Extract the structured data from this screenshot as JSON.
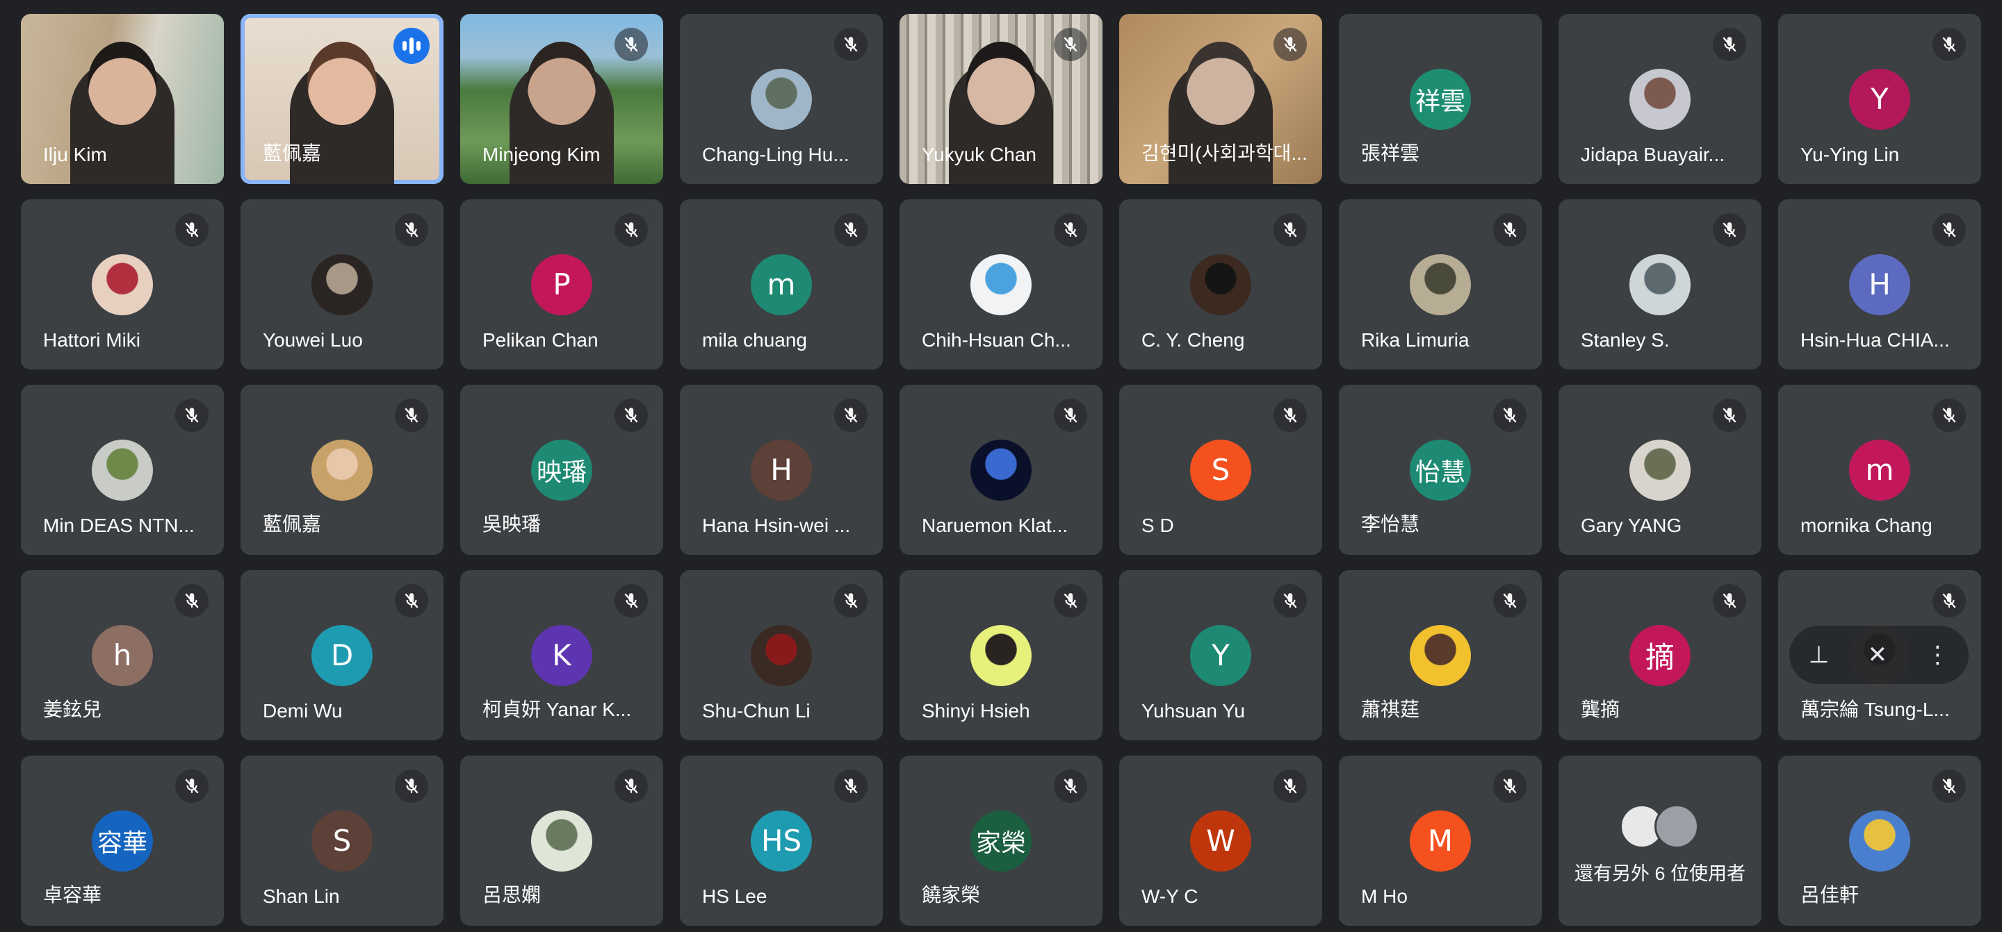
{
  "participants": [
    {
      "name": "Ilju Kim",
      "type": "video",
      "bg": "v1",
      "skin": "#d9b39a",
      "hair": "#1e1a18"
    },
    {
      "name": "藍佩嘉",
      "type": "video",
      "bg": "v2",
      "skin": "#e3b9a0",
      "hair": "#5a3a2a",
      "speaking": true
    },
    {
      "name": "Minjeong Kim",
      "type": "video",
      "bg": "v3",
      "skin": "#c9a48c",
      "hair": "#2b2420",
      "muted": true
    },
    {
      "name": "Chang-Ling Hu...",
      "type": "photo",
      "photo_colors": [
        "#9fb6c9",
        "#5f7060"
      ],
      "muted": true
    },
    {
      "name": "Yukyuk Chan",
      "type": "video",
      "bg": "v5",
      "skin": "#d6b8a4",
      "hair": "#1d1a19",
      "muted": true
    },
    {
      "name": "김현미(사회과학대...",
      "type": "video",
      "bg": "v6",
      "skin": "#cdb3a0",
      "hair": "#3a3330",
      "muted": true
    },
    {
      "name": "張祥雲",
      "type": "initial",
      "initial": "祥雲",
      "color": "#1e8e73"
    },
    {
      "name": "Jidapa Buayair...",
      "type": "photo",
      "photo_colors": [
        "#c7c7cf",
        "#7d5a50"
      ],
      "muted": true
    },
    {
      "name": "Yu-Ying Lin",
      "type": "initial",
      "initial": "Y",
      "color": "#b3185a",
      "muted": true
    },
    {
      "name": "Hattori Miki",
      "type": "photo",
      "photo_colors": [
        "#e8d0c0",
        "#b03040"
      ],
      "muted": true
    },
    {
      "name": "Youwei Luo",
      "type": "photo",
      "photo_colors": [
        "#2a2522",
        "#a89888"
      ],
      "muted": true
    },
    {
      "name": "Pelikan Chan",
      "type": "initial",
      "initial": "P",
      "color": "#c2185b",
      "muted": true
    },
    {
      "name": "mila chuang",
      "type": "initial",
      "initial": "m",
      "color": "#1e8a73",
      "muted": true
    },
    {
      "name": "Chih-Hsuan Ch...",
      "type": "photo",
      "photo_colors": [
        "#f1f3f4",
        "#4aa3df"
      ],
      "muted": true
    },
    {
      "name": "C. Y. Cheng",
      "type": "photo",
      "photo_colors": [
        "#3c2a20",
        "#151515"
      ],
      "muted": true
    },
    {
      "name": "Rika Limuria",
      "type": "photo",
      "photo_colors": [
        "#b7ad95",
        "#4a4a3a"
      ],
      "muted": true
    },
    {
      "name": "Stanley S.",
      "type": "photo",
      "photo_colors": [
        "#cfd6d8",
        "#5d6a70"
      ],
      "muted": true
    },
    {
      "name": "Hsin-Hua CHIA...",
      "type": "initial",
      "initial": "H",
      "color": "#5c6bc0",
      "muted": true
    },
    {
      "name": "Min DEAS NTN...",
      "type": "photo",
      "photo_colors": [
        "#c9cbc7",
        "#6d8a4a"
      ],
      "muted": true
    },
    {
      "name": "藍佩嘉",
      "type": "photo",
      "photo_colors": [
        "#c9a26a",
        "#e8c7a8"
      ],
      "muted": true
    },
    {
      "name": "吳映璠",
      "type": "initial",
      "initial": "映璠",
      "color": "#1e8a73",
      "muted": true
    },
    {
      "name": "Hana Hsin-wei ...",
      "type": "initial",
      "initial": "H",
      "color": "#5d4037",
      "muted": true
    },
    {
      "name": "Naruemon Klat...",
      "type": "photo",
      "photo_colors": [
        "#0a0f2a",
        "#3a6ad0"
      ],
      "muted": true
    },
    {
      "name": "S D",
      "type": "initial",
      "initial": "S",
      "color": "#f4511e",
      "muted": true
    },
    {
      "name": "李怡慧",
      "type": "initial",
      "initial": "怡慧",
      "color": "#1e8a73",
      "muted": true
    },
    {
      "name": "Gary YANG",
      "type": "photo",
      "photo_colors": [
        "#d8d4cc",
        "#6a6f55"
      ],
      "muted": true
    },
    {
      "name": "mornika Chang",
      "type": "initial",
      "initial": "m",
      "color": "#c2185b",
      "muted": true
    },
    {
      "name": "姜鉉兒",
      "type": "initial",
      "initial": "h",
      "color": "#8d6e63",
      "muted": true
    },
    {
      "name": "Demi Wu",
      "type": "initial",
      "initial": "D",
      "color": "#1e9bb0",
      "muted": true
    },
    {
      "name": "柯貞妍 Yanar K...",
      "type": "initial",
      "initial": "K",
      "color": "#5e35b1",
      "muted": true
    },
    {
      "name": "Shu-Chun Li",
      "type": "photo",
      "photo_colors": [
        "#3a2a24",
        "#8a1a1a"
      ],
      "muted": true
    },
    {
      "name": "Shinyi Hsieh",
      "type": "photo",
      "photo_colors": [
        "#e6f07a",
        "#2a2420"
      ],
      "muted": true
    },
    {
      "name": "Yuhsuan Yu",
      "type": "initial",
      "initial": "Y",
      "color": "#1e8a73",
      "muted": true
    },
    {
      "name": "蕭祺莛",
      "type": "photo",
      "photo_colors": [
        "#f2c12e",
        "#5a3a2a"
      ],
      "muted": true
    },
    {
      "name": "龔摘",
      "type": "initial",
      "initial": "摘",
      "color": "#c2185b",
      "muted": true
    },
    {
      "name": "萬宗綸 Tsung-L...",
      "type": "photo",
      "photo_colors": [
        "#4a4040",
        "#2a2626"
      ],
      "muted": true,
      "hovered": true
    },
    {
      "name": "卓容華",
      "type": "initial",
      "initial": "容華",
      "color": "#1565c0",
      "muted": true
    },
    {
      "name": "Shan Lin",
      "type": "initial",
      "initial": "S",
      "color": "#5d4037",
      "muted": true
    },
    {
      "name": "呂思嫻",
      "type": "photo",
      "photo_colors": [
        "#dfe6d8",
        "#6a7a60"
      ],
      "muted": true
    },
    {
      "name": "HS Lee",
      "type": "initial",
      "initial": "HS",
      "color": "#1e9bb0",
      "muted": true
    },
    {
      "name": "饒家榮",
      "type": "initial",
      "initial": "家榮",
      "color": "#1b5e40",
      "muted": true
    },
    {
      "name": "W-Y C",
      "type": "initial",
      "initial": "W",
      "color": "#bf360c",
      "muted": true
    },
    {
      "name": "M Ho",
      "type": "initial",
      "initial": "M",
      "color": "#f4511e",
      "muted": true
    },
    {
      "name": "",
      "type": "others",
      "others_label": "還有另外 6 位使用者"
    },
    {
      "name": "呂佳軒",
      "type": "photo",
      "photo_colors": [
        "#4a7fd0",
        "#e8c040"
      ],
      "muted": true
    }
  ],
  "icons": {
    "muted": "mic-off-icon",
    "speaking": "audio-level-icon",
    "pin": "pin-icon",
    "remove": "mic-off-icon",
    "more": "more-vert-icon"
  },
  "hover_controls": {
    "pin": "⊥",
    "mute": "✕",
    "more": "⋮"
  }
}
